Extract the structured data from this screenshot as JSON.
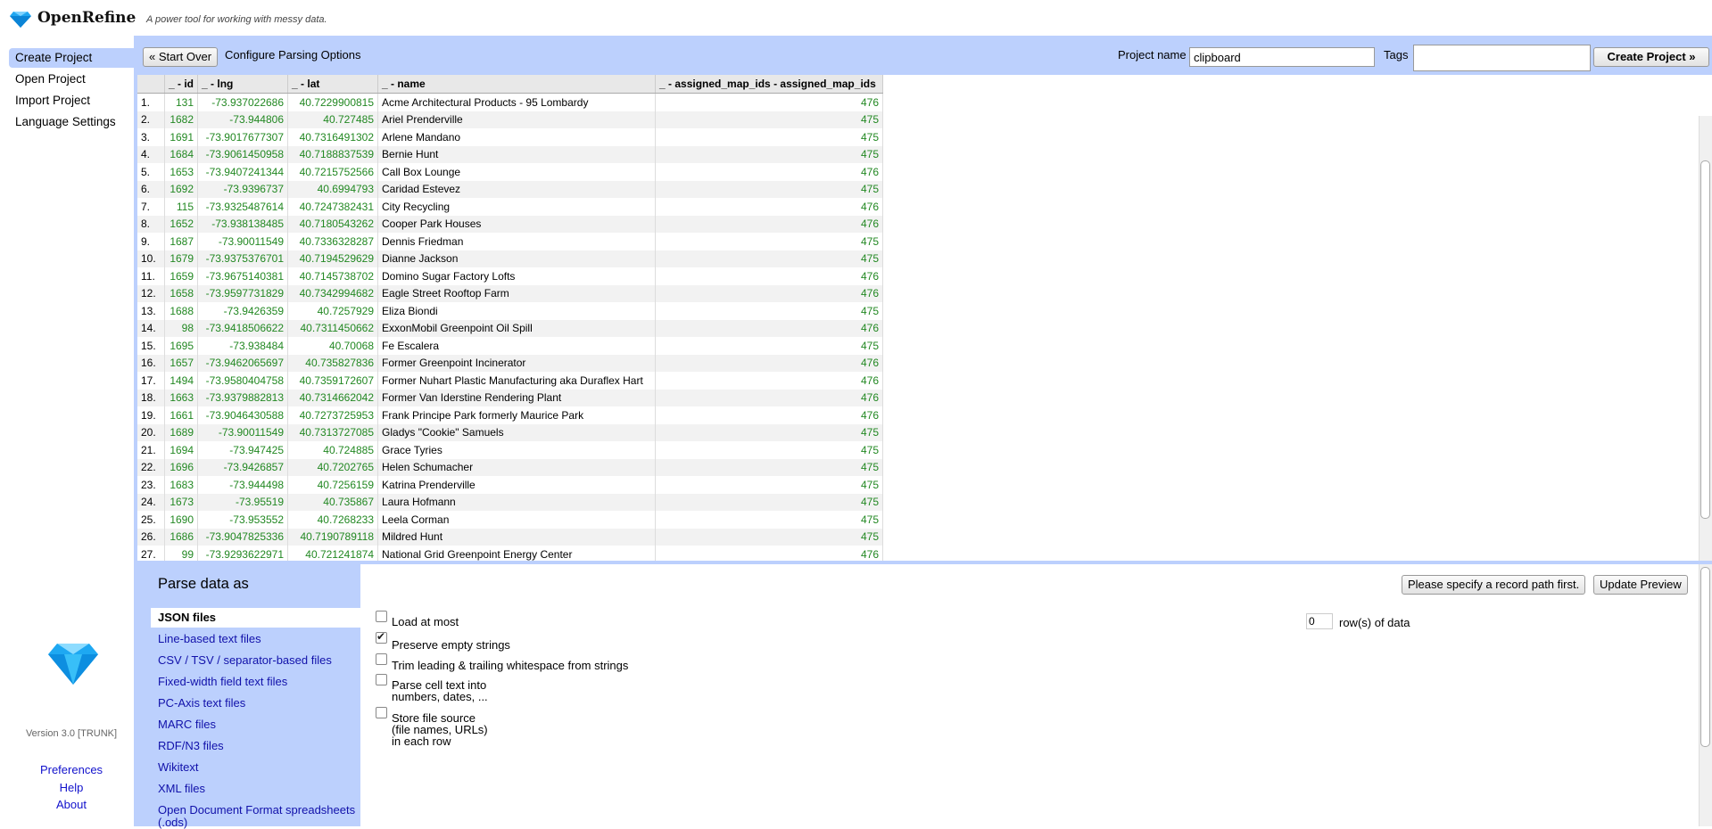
{
  "app": {
    "name": "OpenRefine",
    "tagline": "A power tool for working with messy data."
  },
  "nav": {
    "items": [
      {
        "label": "Create Project",
        "active": true
      },
      {
        "label": "Open Project",
        "active": false
      },
      {
        "label": "Import Project",
        "active": false
      },
      {
        "label": "Language Settings",
        "active": false
      }
    ],
    "version": "Version 3.0 [TRUNK]",
    "footer_links": [
      "Preferences",
      "Help",
      "About"
    ]
  },
  "toolbar": {
    "start_over_label": "« Start Over",
    "configure_label": "Configure Parsing Options",
    "project_name_label": "Project name",
    "project_name_value": "clipboard",
    "tags_label": "Tags",
    "tags_value": "",
    "create_project_label": "Create Project »"
  },
  "table": {
    "columns": [
      "_ - id",
      "_ - lng",
      "_ - lat",
      "_ - name",
      "_ - assigned_map_ids - assigned_map_ids"
    ],
    "rows": [
      [
        "1.",
        "131",
        "-73.937022686",
        "40.7229900815",
        "Acme Architectural Products - 95 Lombardy",
        "476"
      ],
      [
        "2.",
        "1682",
        "-73.944806",
        "40.727485",
        "Ariel Prenderville",
        "475"
      ],
      [
        "3.",
        "1691",
        "-73.9017677307",
        "40.7316491302",
        "Arlene Mandano",
        "475"
      ],
      [
        "4.",
        "1684",
        "-73.9061450958",
        "40.7188837539",
        "Bernie Hunt",
        "475"
      ],
      [
        "5.",
        "1653",
        "-73.9407241344",
        "40.7215752566",
        "Call Box Lounge",
        "476"
      ],
      [
        "6.",
        "1692",
        "-73.9396737",
        "40.6994793",
        "Caridad Estevez",
        "475"
      ],
      [
        "7.",
        "115",
        "-73.9325487614",
        "40.7247382431",
        "City Recycling",
        "476"
      ],
      [
        "8.",
        "1652",
        "-73.938138485",
        "40.7180543262",
        "Cooper Park Houses",
        "476"
      ],
      [
        "9.",
        "1687",
        "-73.90011549",
        "40.7336328287",
        "Dennis Friedman",
        "475"
      ],
      [
        "10.",
        "1679",
        "-73.9375376701",
        "40.7194529629",
        "Dianne Jackson",
        "475"
      ],
      [
        "11.",
        "1659",
        "-73.9675140381",
        "40.7145738702",
        "Domino Sugar Factory Lofts",
        "476"
      ],
      [
        "12.",
        "1658",
        "-73.9597731829",
        "40.7342994682",
        "Eagle Street Rooftop Farm",
        "476"
      ],
      [
        "13.",
        "1688",
        "-73.9426359",
        "40.7257929",
        "Eliza Biondi",
        "475"
      ],
      [
        "14.",
        "98",
        "-73.9418506622",
        "40.7311450662",
        "ExxonMobil Greenpoint Oil Spill",
        "476"
      ],
      [
        "15.",
        "1695",
        "-73.938484",
        "40.70068",
        "Fe Escalera",
        "475"
      ],
      [
        "16.",
        "1657",
        "-73.9462065697",
        "40.735827836",
        "Former Greenpoint Incinerator",
        "476"
      ],
      [
        "17.",
        "1494",
        "-73.9580404758",
        "40.7359172607",
        "Former Nuhart Plastic Manufacturing aka Duraflex Hart",
        "476"
      ],
      [
        "18.",
        "1663",
        "-73.9379882813",
        "40.7314662042",
        "Former Van Iderstine Rendering Plant",
        "476"
      ],
      [
        "19.",
        "1661",
        "-73.9046430588",
        "40.7273725953",
        "Frank Principe Park formerly Maurice Park",
        "476"
      ],
      [
        "20.",
        "1689",
        "-73.90011549",
        "40.7313727085",
        "Gladys \"Cookie\" Samuels",
        "475"
      ],
      [
        "21.",
        "1694",
        "-73.947425",
        "40.724885",
        "Grace Tyries",
        "475"
      ],
      [
        "22.",
        "1696",
        "-73.9426857",
        "40.7202765",
        "Helen Schumacher",
        "475"
      ],
      [
        "23.",
        "1683",
        "-73.944498",
        "40.7256159",
        "Katrina Prenderville",
        "475"
      ],
      [
        "24.",
        "1673",
        "-73.95519",
        "40.735867",
        "Laura Hofmann",
        "475"
      ],
      [
        "25.",
        "1690",
        "-73.953552",
        "40.7268233",
        "Leela Corman",
        "475"
      ],
      [
        "26.",
        "1686",
        "-73.9047825336",
        "40.7190789118",
        "Mildred Hunt",
        "475"
      ],
      [
        "27.",
        "99",
        "-73.9293622971",
        "40.721241874",
        "National Grid Greenpoint Energy Center",
        "476"
      ]
    ]
  },
  "parse": {
    "heading": "Parse data as",
    "formats": [
      {
        "label": "JSON files",
        "selected": true
      },
      {
        "label": "Line-based text files",
        "selected": false
      },
      {
        "label": "CSV / TSV / separator-based files",
        "selected": false
      },
      {
        "label": "Fixed-width field text files",
        "selected": false
      },
      {
        "label": "PC-Axis text files",
        "selected": false
      },
      {
        "label": "MARC files",
        "selected": false
      },
      {
        "label": "RDF/N3 files",
        "selected": false
      },
      {
        "label": "Wikitext",
        "selected": false
      },
      {
        "label": "XML files",
        "selected": false
      },
      {
        "label": "Open Document Format spreadsheets (.ods)",
        "selected": false
      }
    ],
    "record_path_button": "Please specify a record path first.",
    "update_preview_button": "Update Preview",
    "options": {
      "load_at_most": {
        "label": "Load at most",
        "checked": false
      },
      "rows_value": "0",
      "rows_label": "row(s) of data",
      "preserve_empty": {
        "label": "Preserve empty strings",
        "checked": true
      },
      "trim": {
        "label": "Trim leading & trailing whitespace from strings",
        "checked": false
      },
      "parse_cell": {
        "line1": "Parse cell text into",
        "line2": "numbers, dates, ...",
        "checked": false
      },
      "store_source": {
        "line1": "Store file source",
        "line2": "(file names, URLs)",
        "line3": "in each row",
        "checked": false
      }
    }
  },
  "colors": {
    "accent": "#bcd0fd",
    "number_green": "#228822",
    "link_blue": "#1111cc"
  }
}
